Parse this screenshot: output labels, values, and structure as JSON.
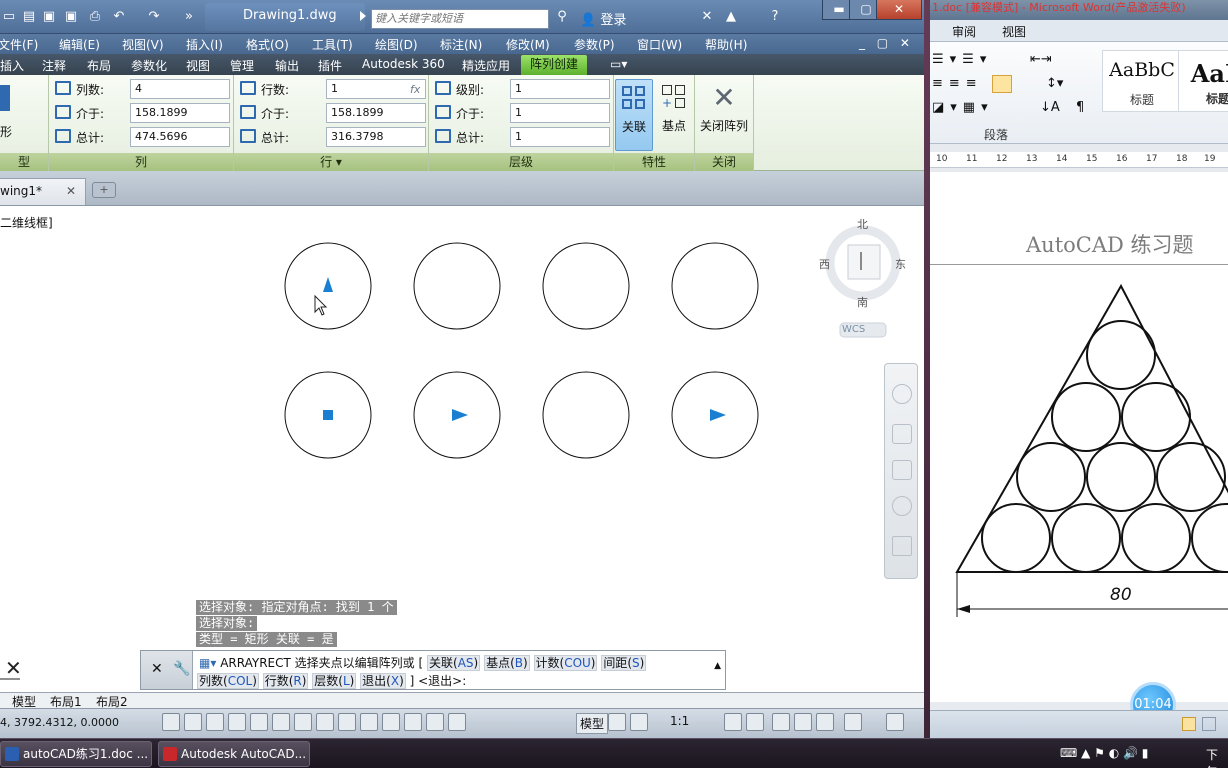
{
  "acad": {
    "doc_title": "Drawing1.dwg",
    "search_placeholder": "键入关键字或短语",
    "login": "登录",
    "menu": [
      "文件(F)",
      "编辑(E)",
      "视图(V)",
      "插入(I)",
      "格式(O)",
      "工具(T)",
      "绘图(D)",
      "标注(N)",
      "修改(M)",
      "参数(P)",
      "窗口(W)",
      "帮助(H)"
    ],
    "ribbon_tabs": [
      "插入",
      "注释",
      "布局",
      "参数化",
      "视图",
      "管理",
      "输出",
      "插件",
      "Autodesk 360",
      "精选应用"
    ],
    "ribbon_active_tab": "阵列创建",
    "type_panel": {
      "icon_text": "形",
      "title": "型"
    },
    "col_panel": {
      "title": "列",
      "count_label": "列数:",
      "count": "4",
      "between_label": "介于:",
      "between": "158.1899",
      "total_label": "总计:",
      "total": "474.5696"
    },
    "row_panel": {
      "title": "行 ▾",
      "count_label": "行数:",
      "count": "1",
      "between_label": "介于:",
      "between": "158.1899",
      "total_label": "总计:",
      "total": "316.3798"
    },
    "level_panel": {
      "title": "层级",
      "count_label": "级别:",
      "count": "1",
      "between_label": "介于:",
      "between": "1",
      "total_label": "总计:",
      "total": "1"
    },
    "props_panel": {
      "title": "特性",
      "assoc": "关联",
      "base": "基点"
    },
    "close_panel": {
      "title": "关闭",
      "close_array": "关闭阵列"
    },
    "file_tab": "wing1*",
    "viewport_label": "二维线框]",
    "viewcube": {
      "north": "北",
      "south": "南",
      "west": "西",
      "east": "东",
      "wcs": "WCS"
    },
    "cmd_history": [
      "选择对象: 指定对角点: 找到 1 个",
      "选择对象:",
      "类型 = 矩形  关联 = 是"
    ],
    "cmd": {
      "command": "ARRAYRECT",
      "prompt": "选择夹点以编辑阵列或",
      "options_line1": [
        {
          "label": "关联(",
          "key": "AS",
          "end": ")"
        },
        {
          "label": "基点(",
          "key": "B",
          "end": ")"
        },
        {
          "label": "计数(",
          "key": "COU",
          "end": ")"
        },
        {
          "label": "间距(",
          "key": "S",
          "end": ")"
        }
      ],
      "options_line2": [
        {
          "label": "列数(",
          "key": "COL",
          "end": ")"
        },
        {
          "label": "行数(",
          "key": "R",
          "end": ")"
        },
        {
          "label": "层数(",
          "key": "L",
          "end": ")"
        },
        {
          "label": "退出(",
          "key": "X",
          "end": ")"
        }
      ],
      "default": "<退出>:"
    },
    "layout_tabs": [
      "模型",
      "布局1",
      "布局2"
    ],
    "coords": "4,  3792.4312,  0.0000",
    "status_model": "模型",
    "status_scale": "1:1"
  },
  "word": {
    "title": "1.doc [兼容模式] - Microsoft Word(产品激活失败)",
    "tabs": [
      "审阅",
      "视图"
    ],
    "styles": [
      {
        "sample": "AaBbC",
        "name": "标题"
      },
      {
        "sample": "AaB",
        "name": "标题"
      }
    ],
    "paragraph_label": "段落",
    "ruler_numbers": [
      "10",
      "11",
      "12",
      "13",
      "14",
      "15",
      "16",
      "17",
      "18",
      "19"
    ],
    "doc_title": "AutoCAD 练习题",
    "dimension": "80",
    "timer": "01:04"
  },
  "taskbar": {
    "items": [
      {
        "label": "autoCAD练习1.doc ..."
      },
      {
        "label": "Autodesk AutoCAD..."
      }
    ],
    "clock": "下午"
  },
  "colors": {
    "ribbon_active": "#7ccb48",
    "accent_blue": "#1a7fd0"
  }
}
